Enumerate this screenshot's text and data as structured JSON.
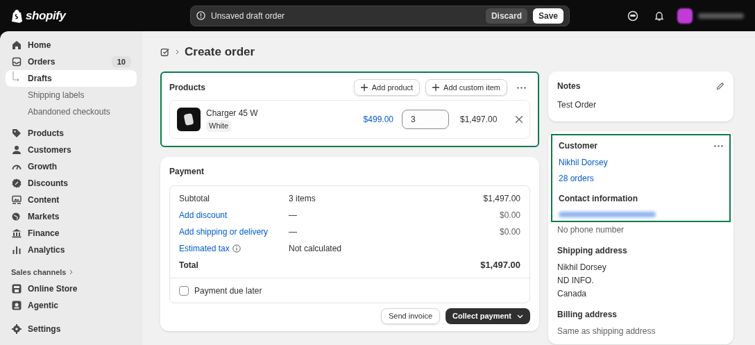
{
  "topbar": {
    "logo": "shopify",
    "notice": "Unsaved draft order",
    "discard": "Discard",
    "save": "Save"
  },
  "sidebar": {
    "items": [
      {
        "label": "Home",
        "selected": false
      },
      {
        "label": "Orders",
        "selected": false,
        "badge": "10",
        "children": [
          {
            "label": "Drafts",
            "selected": true
          },
          {
            "label": "Shipping labels",
            "selected": false
          },
          {
            "label": "Abandoned checkouts",
            "selected": false
          }
        ]
      },
      {
        "label": "Products",
        "selected": false
      },
      {
        "label": "Customers",
        "selected": false
      },
      {
        "label": "Growth",
        "selected": false
      },
      {
        "label": "Discounts",
        "selected": false
      },
      {
        "label": "Content",
        "selected": false
      },
      {
        "label": "Markets",
        "selected": false
      },
      {
        "label": "Finance",
        "selected": false
      },
      {
        "label": "Analytics",
        "selected": false
      }
    ],
    "sales_channels": {
      "title": "Sales channels",
      "items": [
        {
          "label": "Online Store",
          "selected": false
        },
        {
          "label": "Agentic",
          "selected": false
        }
      ]
    },
    "settings": {
      "label": "Settings",
      "selected": false
    }
  },
  "page_title": "Create order",
  "products": {
    "title": "Products",
    "highlighted": true,
    "buttons": [
      "Add product",
      "Add custom item"
    ],
    "items": [
      {
        "name": "Charger 45 W",
        "variant": "White",
        "price": "$499.00",
        "quantity": "3",
        "total": "$1,497.00"
      }
    ]
  },
  "payment": {
    "title": "Payment",
    "rows": [
      {
        "kind": "text",
        "label": "Subtotal",
        "detail": "3 items",
        "amount": "$1,497.00"
      },
      {
        "kind": "link",
        "label": "Add discount",
        "detail": "—",
        "amount": "$0.00"
      },
      {
        "kind": "link",
        "label": "Add shipping or delivery",
        "detail": "—",
        "amount": "$0.00"
      },
      {
        "kind": "info",
        "label": "Estimated tax",
        "detail": "Not calculated"
      },
      {
        "kind": "total",
        "label": "Total",
        "amount": "$1,497.00"
      }
    ],
    "due_later": {
      "label": "Payment due later",
      "checked": false
    },
    "send_invoice": "Send invoice",
    "collect": "Collect payment"
  },
  "notes": {
    "title": "Notes",
    "text": "Test Order"
  },
  "customer": {
    "title": "Customer",
    "highlighted": true,
    "name": "Nikhil Dorsey",
    "orders": "28 orders",
    "contact_title": "Contact information",
    "phone": "No phone number",
    "shipping_title": "Shipping address",
    "shipping_lines": [
      "Nikhil Dorsey",
      "ND INFO.",
      "Canada"
    ],
    "billing_title": "Billing address",
    "billing_text": "Same as shipping address"
  }
}
